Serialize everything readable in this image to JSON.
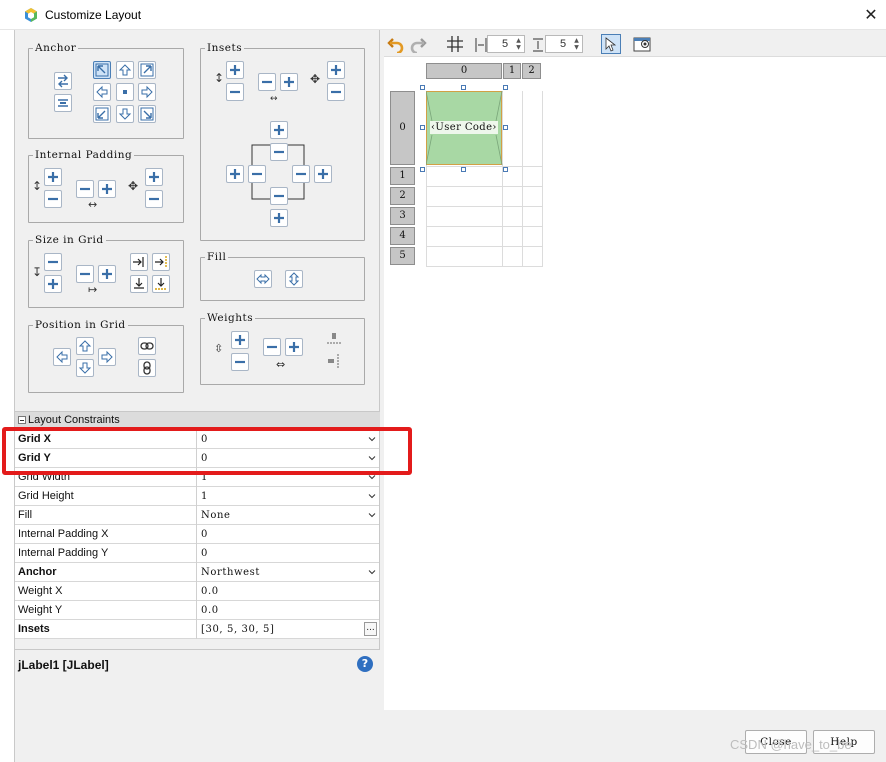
{
  "window": {
    "title": "Customize Layout",
    "close_glyph": "✕"
  },
  "groups": {
    "anchor": "Anchor",
    "insets": "Insets",
    "internal_padding": "Internal Padding",
    "size_in_grid": "Size in Grid",
    "fill": "Fill",
    "position_in_grid": "Position in Grid",
    "weights": "Weights"
  },
  "constraints": {
    "header": "Layout Constraints",
    "rows": [
      {
        "label": "Grid X",
        "value": "0",
        "bold": true,
        "dropdown": true
      },
      {
        "label": "Grid Y",
        "value": "0",
        "bold": true,
        "dropdown": true
      },
      {
        "label": "Grid Width",
        "value": "1",
        "bold": false,
        "dropdown": true
      },
      {
        "label": "Grid Height",
        "value": "1",
        "bold": false,
        "dropdown": true
      },
      {
        "label": "Fill",
        "value": "None",
        "bold": false,
        "dropdown": true
      },
      {
        "label": "Internal Padding X",
        "value": "0",
        "bold": false,
        "dropdown": false
      },
      {
        "label": "Internal Padding Y",
        "value": "0",
        "bold": false,
        "dropdown": false
      },
      {
        "label": "Anchor",
        "value": "Northwest",
        "bold": true,
        "dropdown": true
      },
      {
        "label": "Weight X",
        "value": "0.0",
        "bold": false,
        "dropdown": false
      },
      {
        "label": "Weight Y",
        "value": "0.0",
        "bold": false,
        "dropdown": false
      },
      {
        "label": "Insets",
        "value": "[30, 5, 30, 5]",
        "bold": true,
        "dropdown": false,
        "ellipsis": "..."
      }
    ]
  },
  "info": {
    "component": "jLabel1 [JLabel]",
    "help_glyph": "?"
  },
  "toolbar": {
    "columns_spin": "5",
    "rows_spin": "5"
  },
  "grid": {
    "col_headers": [
      "0",
      "1",
      "2"
    ],
    "row_headers": [
      "0",
      "1",
      "2",
      "3",
      "4",
      "5"
    ],
    "component_label": "‹User Code›"
  },
  "buttons": {
    "close": "Close",
    "help": "Help"
  },
  "watermark": "CSDN @have_to_be",
  "colors": {
    "annotation": "#e31b1b",
    "component_fill": "#a8d8a4",
    "accent": "#2f6fc0"
  }
}
